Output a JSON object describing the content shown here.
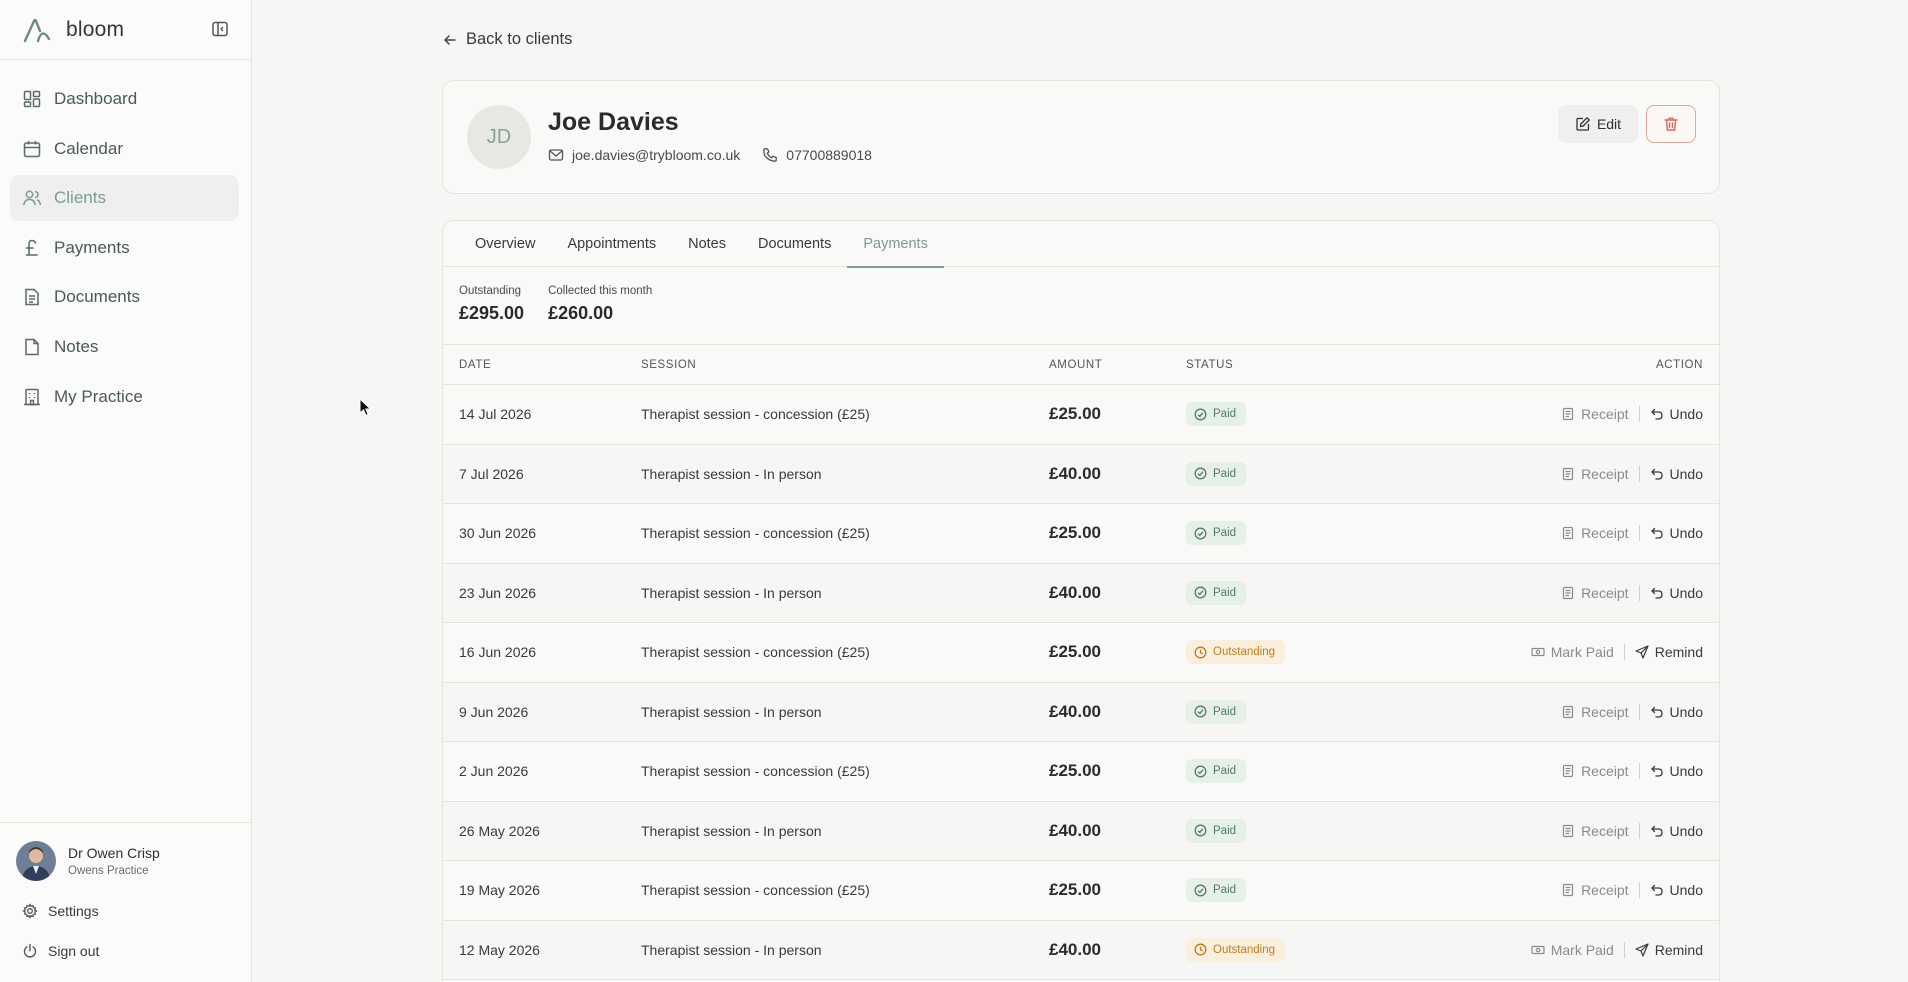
{
  "app": {
    "name": "bloom"
  },
  "sidebar": {
    "items": [
      {
        "label": "Dashboard",
        "icon": "dashboard-icon"
      },
      {
        "label": "Calendar",
        "icon": "calendar-icon"
      },
      {
        "label": "Clients",
        "icon": "users-icon",
        "active": true
      },
      {
        "label": "Payments",
        "icon": "pound-icon"
      },
      {
        "label": "Documents",
        "icon": "document-icon"
      },
      {
        "label": "Notes",
        "icon": "note-icon"
      },
      {
        "label": "My Practice",
        "icon": "building-icon"
      }
    ],
    "user": {
      "name": "Dr Owen Crisp",
      "practice": "Owens Practice"
    },
    "settings_label": "Settings",
    "signout_label": "Sign out"
  },
  "back_label": "Back to clients",
  "client": {
    "initials": "JD",
    "name": "Joe Davies",
    "email": "joe.davies@trybloom.co.uk",
    "phone": "07700889018",
    "edit_label": "Edit"
  },
  "tabs": [
    {
      "label": "Overview"
    },
    {
      "label": "Appointments"
    },
    {
      "label": "Notes"
    },
    {
      "label": "Documents"
    },
    {
      "label": "Payments",
      "active": true
    }
  ],
  "summary": {
    "outstanding_label": "Outstanding",
    "outstanding_value": "£295.00",
    "collected_label": "Collected this month",
    "collected_value": "£260.00"
  },
  "table": {
    "headers": {
      "date": "DATE",
      "session": "SESSION",
      "amount": "AMOUNT",
      "status": "STATUS",
      "action": "ACTION"
    },
    "rows": [
      {
        "date": "14 Jul 2026",
        "session": "Therapist session - concession (£25)",
        "amount": "£25.00",
        "status": "Paid"
      },
      {
        "date": "7 Jul 2026",
        "session": "Therapist session - In person",
        "amount": "£40.00",
        "status": "Paid"
      },
      {
        "date": "30 Jun 2026",
        "session": "Therapist session - concession (£25)",
        "amount": "£25.00",
        "status": "Paid"
      },
      {
        "date": "23 Jun 2026",
        "session": "Therapist session - In person",
        "amount": "£40.00",
        "status": "Paid"
      },
      {
        "date": "16 Jun 2026",
        "session": "Therapist session - concession (£25)",
        "amount": "£25.00",
        "status": "Outstanding"
      },
      {
        "date": "9 Jun 2026",
        "session": "Therapist session - In person",
        "amount": "£40.00",
        "status": "Paid"
      },
      {
        "date": "2 Jun 2026",
        "session": "Therapist session - concession (£25)",
        "amount": "£25.00",
        "status": "Paid"
      },
      {
        "date": "26 May 2026",
        "session": "Therapist session - In person",
        "amount": "£40.00",
        "status": "Paid"
      },
      {
        "date": "19 May 2026",
        "session": "Therapist session - concession (£25)",
        "amount": "£25.00",
        "status": "Paid"
      },
      {
        "date": "12 May 2026",
        "session": "Therapist session - In person",
        "amount": "£40.00",
        "status": "Outstanding"
      }
    ],
    "paid_actions": {
      "primary": "Receipt",
      "secondary": "Undo"
    },
    "outstanding_actions": {
      "primary": "Mark Paid",
      "secondary": "Remind"
    }
  },
  "colors": {
    "accent": "#7f9a91",
    "paid_bg": "#e7efe9",
    "paid_text": "#4f7e62",
    "outstanding_bg": "#faefdc",
    "outstanding_text": "#c27a1d",
    "danger": "#d9695a"
  }
}
